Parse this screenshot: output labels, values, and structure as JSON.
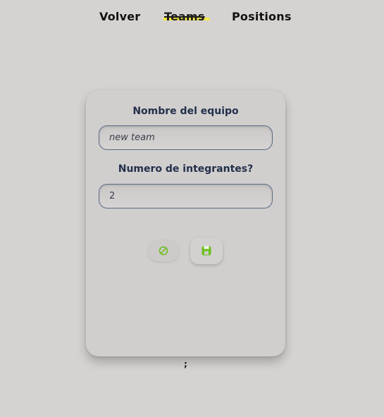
{
  "nav": {
    "back_label": "Volver",
    "teams_label": "Teams",
    "positions_label": "Positions"
  },
  "form": {
    "team_name_label": "Nombre del equipo",
    "team_name_value": "new team",
    "member_count_label": "Numero de integrantes?",
    "member_count_value": "2"
  },
  "actions": {
    "cancel_icon": "cancel-icon",
    "save_icon": "save-icon",
    "accent_color": "#6cbf1d"
  },
  "footer": {
    "mark": ";"
  }
}
